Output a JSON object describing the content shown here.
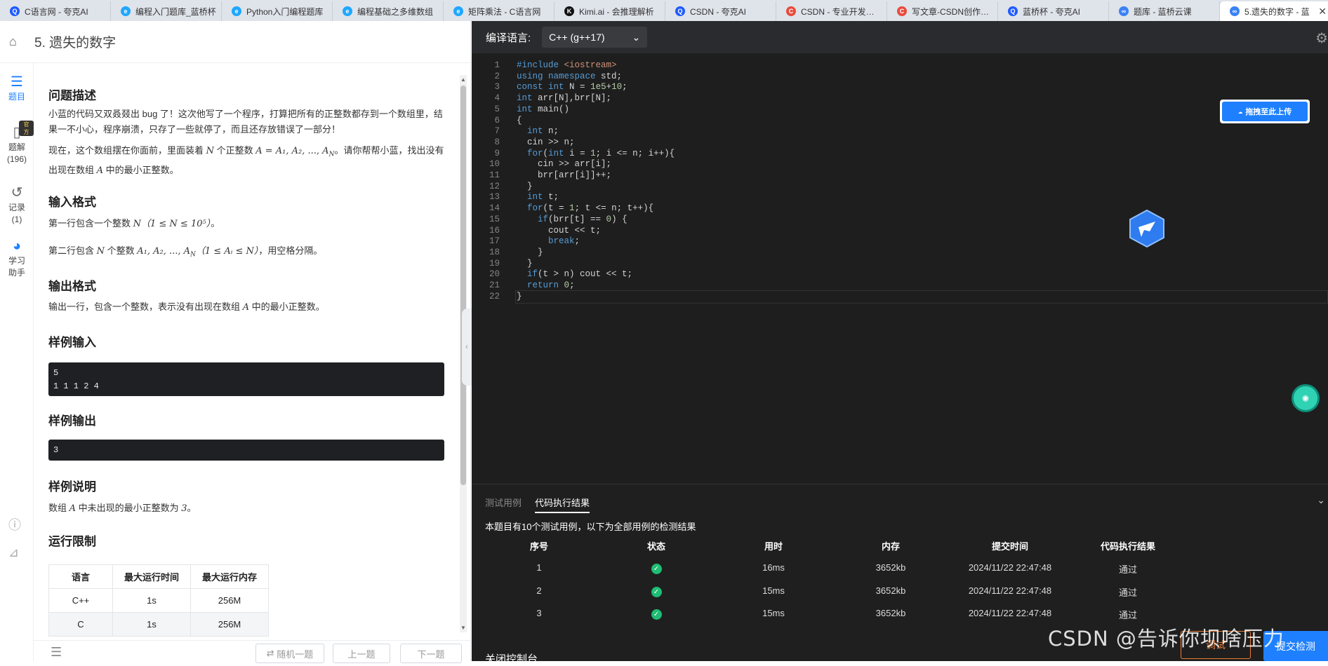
{
  "browser_tabs": [
    {
      "title": "C语言网 - 夸克AI",
      "color": "#1e5bff",
      "glyph": "Q"
    },
    {
      "title": "编程入门题库_蓝桥杯",
      "color": "#1ea7ff",
      "glyph": "e"
    },
    {
      "title": "Python入门编程题库",
      "color": "#1ea7ff",
      "glyph": "e"
    },
    {
      "title": "编程基础之多维数组",
      "color": "#1ea7ff",
      "glyph": "e"
    },
    {
      "title": "矩阵乘法 - C语言网",
      "color": "#1ea7ff",
      "glyph": "e"
    },
    {
      "title": "Kimi.ai - 会推理解析",
      "color": "#111111",
      "glyph": "K"
    },
    {
      "title": "CSDN - 夸克AI",
      "color": "#1e5bff",
      "glyph": "Q"
    },
    {
      "title": "CSDN - 专业开发者社",
      "color": "#e84c3d",
      "glyph": "C"
    },
    {
      "title": "写文章-CSDN创作中心",
      "color": "#e84c3d",
      "glyph": "C"
    },
    {
      "title": "蓝桥杯 - 夸克AI",
      "color": "#1e5bff",
      "glyph": "Q"
    },
    {
      "title": "题库 - 蓝桥云课",
      "color": "#3b82f6",
      "glyph": "∞"
    },
    {
      "title": "5.遗失的数字 - 蓝",
      "color": "#3b82f6",
      "glyph": "∞",
      "active": true
    }
  ],
  "new_tab": "+",
  "problem": {
    "title": "5. 遗失的数字",
    "sections": {
      "desc_h": "问题描述",
      "desc_p1": "小蓝的代码又双叒叕出 bug 了！这次他写了一个程序，打算把所有的正整数都存到一个数组里，结果一不小心，程序崩溃，只存了一些就停了，而且还存放错误了一部分！",
      "desc_p2_a": "现在，这个数组摆在你面前，里面装着 ",
      "desc_p2_n": "N",
      "desc_p2_b": " 个正整数 ",
      "desc_p2_a_math": "A = A₁, A₂, ..., A",
      "desc_p2_sub": "N",
      "desc_p2_c": "。请你帮帮小蓝，找出没有出现在数组 ",
      "desc_p2_A": "A",
      "desc_p2_d": " 中的最小正整数。",
      "input_h": "输入格式",
      "input_p1_a": "第一行包含一个整数 ",
      "input_p1_math": "N（1 ≤ N ≤ 10⁵）",
      "input_p1_b": "。",
      "input_p2_a": "第二行包含 ",
      "input_p2_n": "N",
      "input_p2_b": " 个整数 ",
      "input_p2_math": "A₁, A₂, ..., A",
      "input_p2_sub": "N",
      "input_p2_cond": "（1 ≤ Aᵢ ≤ N）",
      "input_p2_c": "，用空格分隔。",
      "output_h": "输出格式",
      "output_p_a": "输出一行，包含一个整数，表示没有出现在数组 ",
      "output_p_A": "A",
      "output_p_b": " 中的最小正整数。",
      "sample_in_h": "样例输入",
      "sample_in_l1": "5",
      "sample_in_l2": "1 1 1 2 4",
      "sample_out_h": "样例输出",
      "sample_out": "3",
      "explain_h": "样例说明",
      "explain_a": "数组 ",
      "explain_A": "A",
      "explain_b": " 中未出现的最小正整数为 ",
      "explain_v": "3",
      "explain_c": "。",
      "limit_h": "运行限制"
    },
    "limits": {
      "headers": [
        "语言",
        "最大运行时间",
        "最大运行内存"
      ],
      "rows": [
        [
          "C++",
          "1s",
          "256M"
        ],
        [
          "C",
          "1s",
          "256M"
        ]
      ]
    }
  },
  "rail": {
    "items": [
      {
        "label": "题目",
        "icon": "list-icon"
      },
      {
        "label": "题解",
        "sub": "(196)",
        "badge": "官方",
        "icon": "book-icon"
      },
      {
        "label": "记录",
        "sub": "(1)",
        "icon": "history-icon"
      },
      {
        "label": "学习\n助手",
        "icon": "robot-icon"
      }
    ]
  },
  "bottom_buttons": {
    "random": "随机一题",
    "prev": "上一题",
    "next": "下一题"
  },
  "editor": {
    "lang_label": "编译语言:",
    "lang_value": "C++ (g++17)",
    "upload_label": "拖拽至此上传",
    "code": [
      "#include <iostream>",
      "using namespace std;",
      "const int N = 1e5+10;",
      "int arr[N],brr[N];",
      "int main()",
      "{",
      "  int n;",
      "  cin >> n;",
      "  for(int i = 1; i <= n; i++){",
      "    cin >> arr[i];",
      "    brr[arr[i]]++;",
      "  }",
      "  int t;",
      "  for(t = 1; t <= n; t++){",
      "    if(brr[t] == 0) {",
      "      cout << t;",
      "      break;",
      "    }",
      "  }",
      "  if(t > n) cout << t;",
      "  return 0;",
      "}"
    ]
  },
  "console": {
    "tabs": [
      "测试用例",
      "代码执行结果"
    ],
    "active_tab": 1,
    "info": "本题目有10个测试用例，以下为全部用例的检测结果",
    "headers": [
      "序号",
      "状态",
      "用时",
      "内存",
      "提交时间",
      "代码执行结果"
    ],
    "rows": [
      [
        "1",
        "✓",
        "16ms",
        "3652kb",
        "2024/11/22 22:47:48",
        "通过"
      ],
      [
        "2",
        "✓",
        "15ms",
        "3652kb",
        "2024/11/22 22:47:48",
        "通过"
      ],
      [
        "3",
        "✓",
        "15ms",
        "3652kb",
        "2024/11/22 22:47:48",
        "通过"
      ]
    ],
    "close_label": "关闭控制台",
    "debug_label": "调试",
    "submit_label": "提交检测"
  },
  "watermark": "CSDN @告诉你坝啥压力",
  "colors": {
    "accent": "#1e80ff",
    "pass": "#1ebd73",
    "debug": "#e97b36"
  }
}
